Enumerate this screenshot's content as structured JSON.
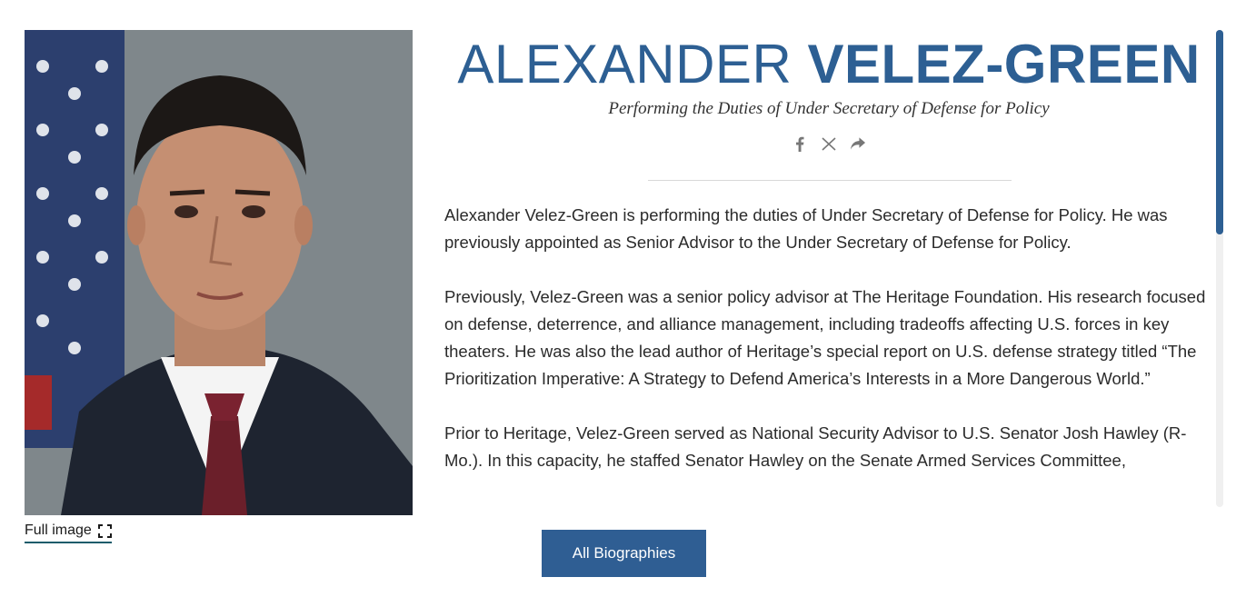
{
  "photo": {
    "alt": "Alexander Velez-Green portrait",
    "full_image_label": "Full image",
    "expand_icon": "expand-icon"
  },
  "header": {
    "first_name": "ALEXANDER",
    "last_name": "VELEZ-GREEN",
    "title": "Performing the Duties of Under Secretary of Defense for Policy"
  },
  "share": [
    {
      "name": "facebook-icon"
    },
    {
      "name": "x-icon"
    },
    {
      "name": "share-icon"
    }
  ],
  "bio": {
    "paragraphs": [
      "Alexander Velez-Green is performing the duties of Under Secretary of Defense for Policy. He was previously appointed as Senior Advisor to the Under Secretary of Defense for Policy.",
      "Previously, Velez-Green was a senior policy advisor at The Heritage Foundation. His research focused on defense, deterrence, and alliance management, including tradeoffs affecting U.S. forces in key theaters. He was also the lead author of Heritage’s special report on U.S. defense strategy titled “The Prioritization Imperative: A Strategy to Defend America’s Interests in a More Dangerous World.”",
      "Prior to Heritage, Velez-Green served as National Security Advisor to U.S. Senator Josh Hawley (R-Mo.). In this capacity, he staffed Senator Hawley on the Senate Armed Services Committee,"
    ]
  },
  "actions": {
    "all_biographies_label": "All Biographies"
  },
  "colors": {
    "accent": "#2d5f93",
    "button": "#2f5e93"
  }
}
